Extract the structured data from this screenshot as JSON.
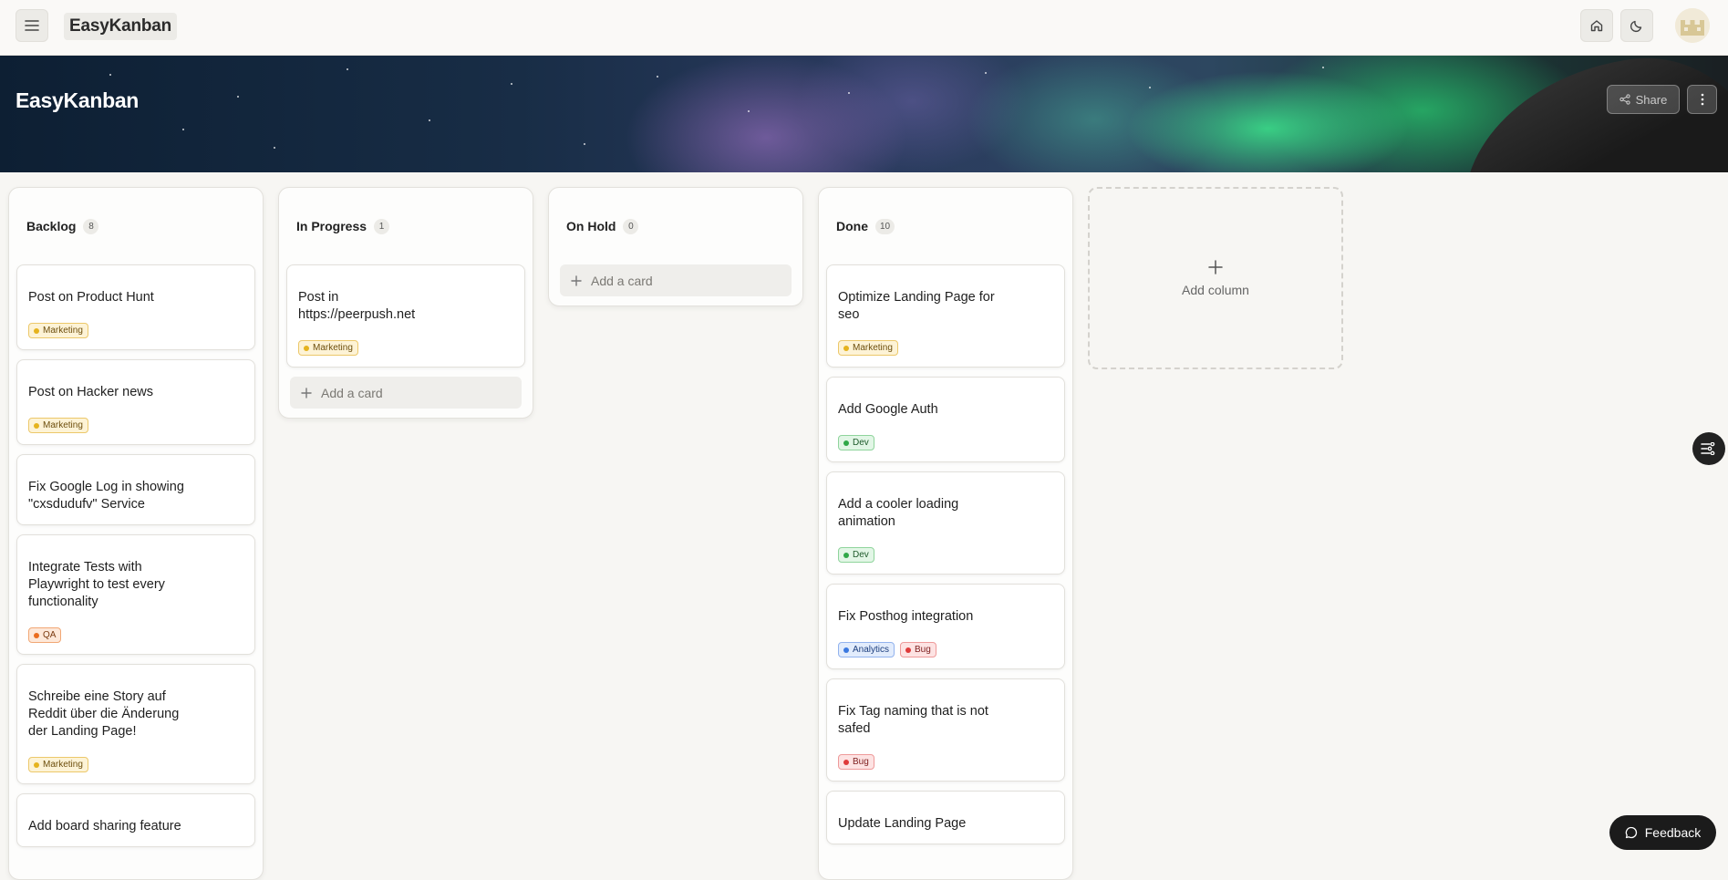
{
  "app": {
    "brand": "EasyKanban"
  },
  "topbar": {
    "icons": [
      "menu-icon",
      "home-icon",
      "moon-icon",
      "avatar"
    ]
  },
  "banner": {
    "title": "EasyKanban",
    "share_label": "Share"
  },
  "columns": [
    {
      "title": "Backlog",
      "count": "8",
      "cards": [
        {
          "title": "Post on Product Hunt",
          "tags": [
            "Marketing"
          ]
        },
        {
          "title": "Post on Hacker news",
          "tags": [
            "Marketing"
          ]
        },
        {
          "title": "Fix Google Log in showing \"cxsdudufv\" Service",
          "tags": []
        },
        {
          "title": "Integrate Tests with Playwright to test every functionality",
          "tags": [
            "QA"
          ]
        },
        {
          "title": "Schreibe eine Story auf Reddit über die Änderung der Landing Page!",
          "tags": [
            "Marketing"
          ]
        },
        {
          "title": "Add board sharing feature",
          "tags": []
        }
      ]
    },
    {
      "title": "In Progress",
      "count": "1",
      "cards": [
        {
          "title": "Post in https://peerpush.net",
          "tags": [
            "Marketing"
          ]
        }
      ],
      "add_card_label": "Add a card"
    },
    {
      "title": "On Hold",
      "count": "0",
      "cards": [],
      "add_card_label": "Add a card"
    },
    {
      "title": "Done",
      "count": "10",
      "cards": [
        {
          "title": "Optimize Landing Page for seo",
          "tags": [
            "Marketing"
          ]
        },
        {
          "title": "Add Google Auth",
          "tags": [
            "Dev"
          ]
        },
        {
          "title": "Add a cooler loading animation",
          "tags": [
            "Dev"
          ]
        },
        {
          "title": "Fix Posthog integration",
          "tags": [
            "Analytics",
            "Bug"
          ]
        },
        {
          "title": "Fix Tag naming that is not safed",
          "tags": [
            "Bug"
          ]
        },
        {
          "title": "Update Landing Page",
          "tags": []
        }
      ]
    }
  ],
  "add_column_label": "Add column",
  "feedback_label": "Feedback",
  "colors": {
    "marketing": "#e5b31e",
    "dev": "#2fa848",
    "qa": "#ea6c1e",
    "analytics": "#3a78e0",
    "bug": "#df3a3a"
  }
}
